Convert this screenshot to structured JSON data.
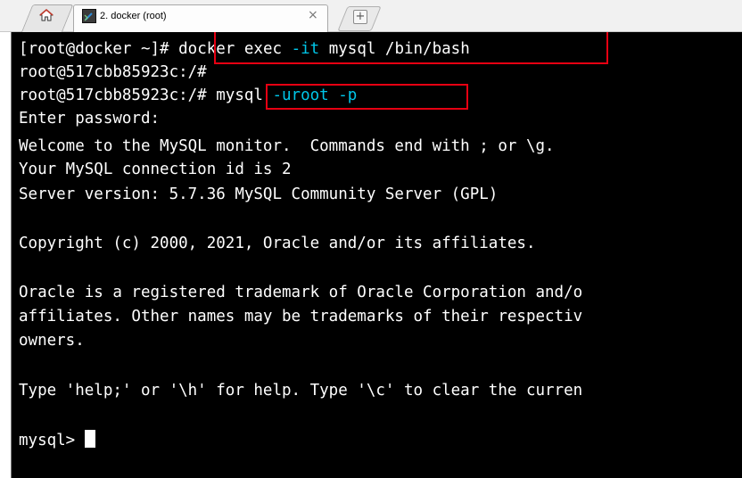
{
  "tab": {
    "title": "2. docker (root)",
    "close": "×",
    "new_tab_symbol": "+",
    "home_icon": "home-icon",
    "terminal_icon": "terminal-icon"
  },
  "terminal": {
    "line1_prompt": "[root@docker ~]# ",
    "line1_cmd_a": "docker exec ",
    "line1_cmd_flag": "-it",
    "line1_cmd_b": " mysql /bin/bash",
    "line2": "root@517cbb85923c:/#",
    "line3_prompt": "root@517cbb85923c:/# ",
    "line3_cmd": "mysql ",
    "line3_flags": "-uroot -p",
    "line4": "Enter password:",
    "line5": "Welcome to the MySQL monitor.  Commands end with ; or \\g.",
    "line6": "Your MySQL connection id is 2",
    "line7": "Server version: 5.7.36 MySQL Community Server (GPL)",
    "line9": "Copyright (c) 2000, 2021, Oracle and/or its affiliates.",
    "line11": "Oracle is a registered trademark of Oracle Corporation and/o",
    "line12": "affiliates. Other names may be trademarks of their respectiv",
    "line13": "owners.",
    "line15": "Type 'help;' or '\\h' for help. Type '\\c' to clear the curren",
    "line17_prompt": "mysql> "
  },
  "colors": {
    "background": "#000000",
    "text": "#ffffff",
    "highlight_cyan": "#00c6e8",
    "annotation_red": "#e60012"
  }
}
